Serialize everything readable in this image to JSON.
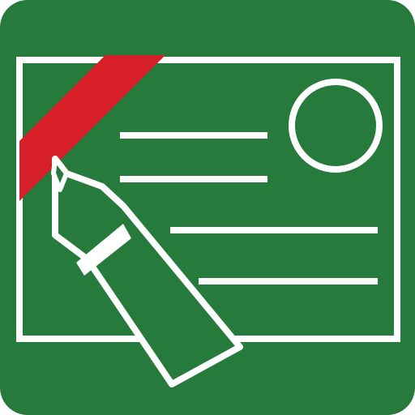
{
  "icon": {
    "name": "certificate-edit-icon",
    "description_visible_text": ""
  },
  "colors": {
    "background": "#267A3C",
    "stroke": "#FFFFFF",
    "ribbon": "#D61F26",
    "page": "#FFFFFF"
  },
  "parts": {
    "tile": "rounded-square-background",
    "card": "certificate-card-outline",
    "ribbon": "corner-ribbon",
    "seal": "seal-circle",
    "lines": [
      "text-line-1",
      "text-line-2",
      "text-line-3",
      "text-line-4"
    ],
    "pen": "highlighter-marker"
  }
}
